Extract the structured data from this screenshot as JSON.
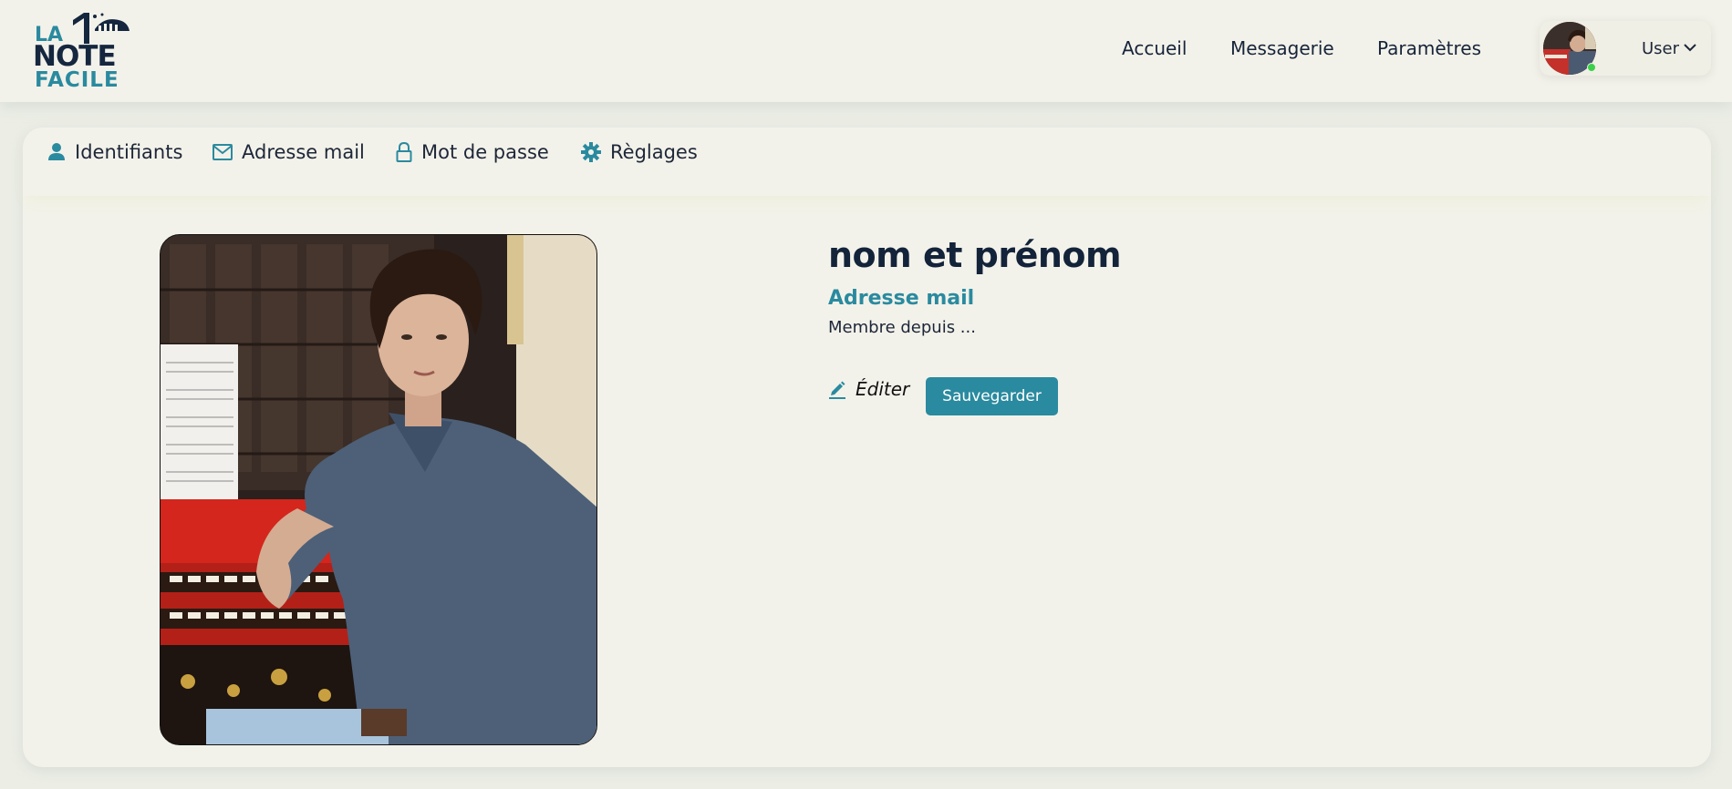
{
  "header": {
    "logo": {
      "line1": "LA",
      "line2": "NOTE",
      "line3": "FACILE"
    },
    "nav": [
      {
        "label": "Accueil"
      },
      {
        "label": "Messagerie"
      },
      {
        "label": "Paramètres"
      }
    ],
    "user": {
      "label": "User",
      "status": "online",
      "status_color": "#3bd04a"
    }
  },
  "tabs": [
    {
      "label": "Identifiants",
      "icon": "person-icon"
    },
    {
      "label": "Adresse mail",
      "icon": "mail-icon"
    },
    {
      "label": "Mot de passe",
      "icon": "lock-icon"
    },
    {
      "label": "Règlages",
      "icon": "gear-icon"
    }
  ],
  "profile": {
    "name": "nom et prénom",
    "email": "Adresse mail",
    "member_since": "Membre depuis ...",
    "edit_label": "Éditer",
    "save_label": "Sauvegarder"
  },
  "colors": {
    "accent": "#2a8a9f",
    "dark": "#13233a",
    "background": "#f3f2ea"
  }
}
